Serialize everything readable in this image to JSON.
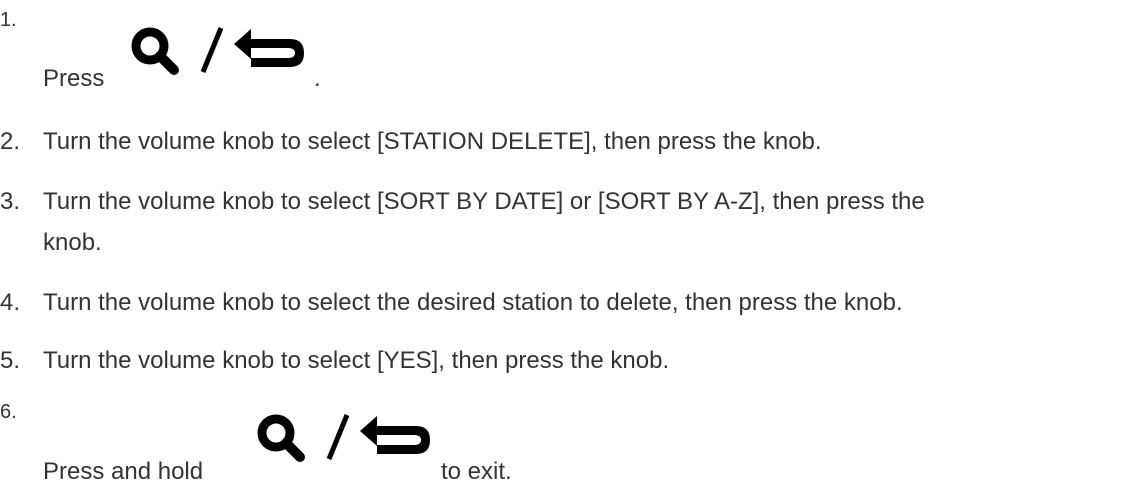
{
  "steps": [
    {
      "number": "1.",
      "text": "Press",
      "icon": "search-back-icon",
      "suffix": "."
    },
    {
      "number": "2.",
      "text": "Turn the volume knob to select [STATION DELETE], then press the knob."
    },
    {
      "number": "3.",
      "line1": "Turn the volume knob to select [SORT BY DATE] or [SORT BY A-Z], then press the",
      "line2": "knob."
    },
    {
      "number": "4.",
      "text": "Turn the volume knob to select the desired station to delete, then press the knob."
    },
    {
      "number": "5.",
      "text": "Turn the volume knob to select [YES], then press the knob."
    },
    {
      "number": "6.",
      "text": "Press and hold",
      "icon": "search-back-icon",
      "suffix": "to exit."
    }
  ]
}
